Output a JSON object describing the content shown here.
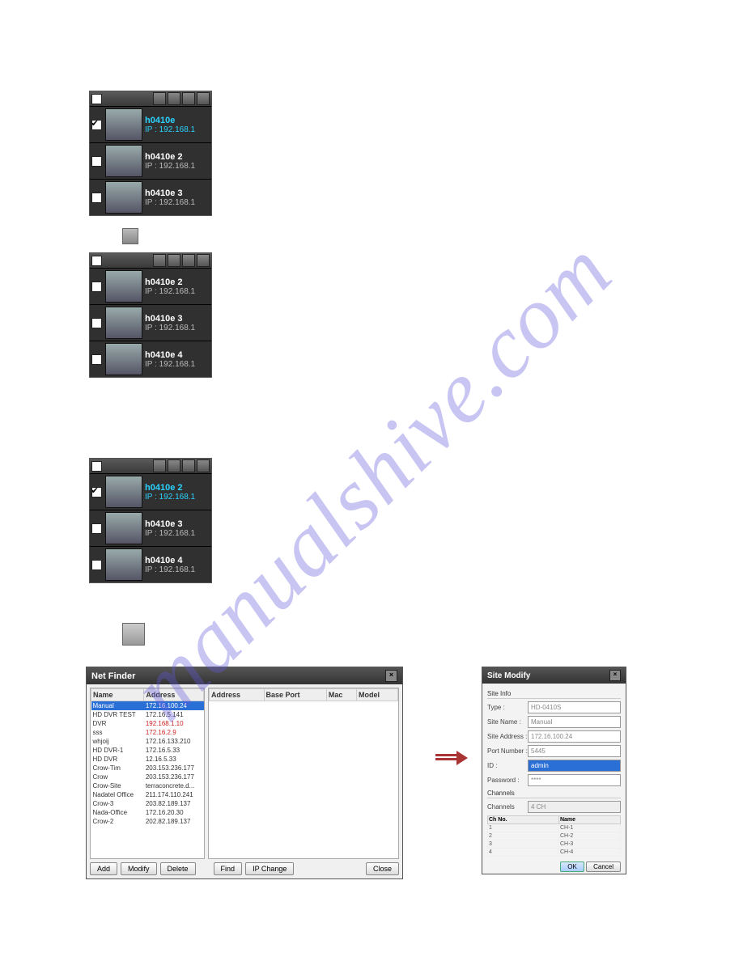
{
  "watermark": "manualshive.com",
  "panel1": {
    "rows": [
      {
        "checked": true,
        "name": "h0410e",
        "ip": "IP : 192.168.1",
        "hl": true
      },
      {
        "checked": false,
        "name": "h0410e 2",
        "ip": "IP : 192.168.1"
      },
      {
        "checked": false,
        "name": "h0410e 3",
        "ip": "IP : 192.168.1"
      }
    ]
  },
  "panel2": {
    "rows": [
      {
        "checked": false,
        "name": "h0410e 2",
        "ip": "IP : 192.168.1"
      },
      {
        "checked": false,
        "name": "h0410e 3",
        "ip": "IP : 192.168.1"
      },
      {
        "checked": false,
        "name": "h0410e 4",
        "ip": "IP : 192.168.1"
      }
    ]
  },
  "panel3": {
    "rows": [
      {
        "checked": true,
        "name": "h0410e 2",
        "ip": "IP : 192.168.1",
        "hl": true
      },
      {
        "checked": false,
        "name": "h0410e 3",
        "ip": "IP : 192.168.1"
      },
      {
        "checked": false,
        "name": "h0410e 4",
        "ip": "IP : 192.168.1"
      }
    ]
  },
  "netfinder": {
    "title": "Net Finder",
    "left_headers": [
      "Name",
      "Address"
    ],
    "right_headers": [
      "Address",
      "Base Port",
      "Mac",
      "Model"
    ],
    "rows": [
      {
        "name": "Manual",
        "addr": "172.16.100.24",
        "sel": true
      },
      {
        "name": "HD DVR TEST",
        "addr": "172.16.5.141"
      },
      {
        "name": "DVR",
        "addr": "192.168.1.10",
        "red": true
      },
      {
        "name": "sss",
        "addr": "172.16.2.9",
        "red": true
      },
      {
        "name": "whjoij",
        "addr": "172.16.133.210"
      },
      {
        "name": "HD DVR-1",
        "addr": "172.16.5.33"
      },
      {
        "name": "HD DVR",
        "addr": "12.16.5.33"
      },
      {
        "name": "Crow-Tim",
        "addr": "203.153.236.177"
      },
      {
        "name": "Crow",
        "addr": "203.153.236.177"
      },
      {
        "name": "Crow-Site",
        "addr": "terraconcrete.d..."
      },
      {
        "name": "Nadatel Office",
        "addr": "211.174.110.241"
      },
      {
        "name": "Crow-3",
        "addr": "203.82.189.137"
      },
      {
        "name": "Nada-Office",
        "addr": "172.16.20.30"
      },
      {
        "name": "Crow-2",
        "addr": "202.82.189.137"
      }
    ],
    "buttons": {
      "add": "Add",
      "modify": "Modify",
      "delete": "Delete",
      "find": "Find",
      "ipchange": "IP Change",
      "close": "Close"
    }
  },
  "sitemodify": {
    "title": "Site Modify",
    "sect_siteinfo": "Site Info",
    "type_label": "Type :",
    "type_value": "HD-0410S",
    "sitename_label": "Site Name :",
    "sitename_value": "Manual",
    "siteaddr_label": "Site Address :",
    "siteaddr_value": "172.16.100.24",
    "port_label": "Port Number :",
    "port_value": "5445",
    "id_label": "ID :",
    "id_value": "admin",
    "pwd_label": "Password :",
    "pwd_value": "****",
    "sect_channels": "Channels",
    "channels_label": "Channels",
    "channels_value": "4 CH",
    "ch_headers": [
      "Ch No.",
      "Name"
    ],
    "ch_rows": [
      {
        "no": "1",
        "name": "CH-1"
      },
      {
        "no": "2",
        "name": "CH-2"
      },
      {
        "no": "3",
        "name": "CH-3"
      },
      {
        "no": "4",
        "name": "CH-4"
      }
    ],
    "ok": "OK",
    "cancel": "Cancel"
  }
}
